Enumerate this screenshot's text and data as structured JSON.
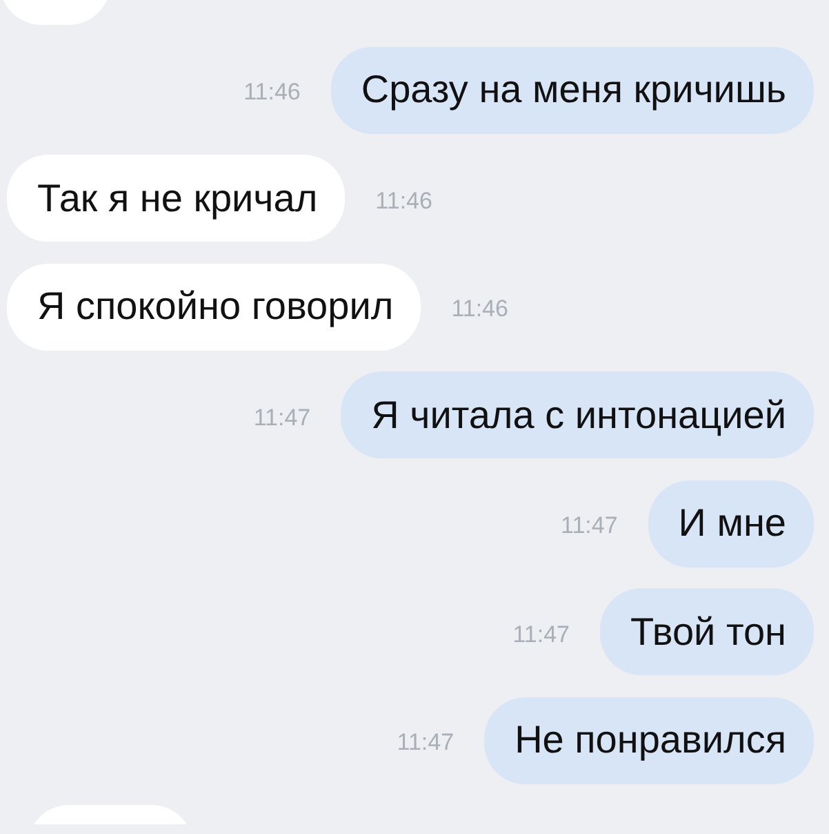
{
  "messages": [
    {
      "kind": "incoming",
      "clipped": true
    },
    {
      "kind": "outgoing",
      "clipped": false,
      "text": "Сразу на меня кричишь",
      "time": "11:46"
    },
    {
      "kind": "incoming",
      "clipped": false,
      "text": "Так я не кричал",
      "time": "11:46"
    },
    {
      "kind": "incoming",
      "clipped": false,
      "text": "Я спокойно говорил",
      "time": "11:46"
    },
    {
      "kind": "outgoing",
      "clipped": false,
      "text": "Я читала с интонацией",
      "time": "11:47"
    },
    {
      "kind": "outgoing",
      "clipped": false,
      "text": "И мне",
      "time": "11:47"
    },
    {
      "kind": "outgoing",
      "clipped": false,
      "text": "Твой тон",
      "time": "11:47"
    },
    {
      "kind": "outgoing",
      "clipped": false,
      "text": "Не понравился",
      "time": "11:47"
    },
    {
      "kind": "incoming",
      "clipped": true
    }
  ]
}
